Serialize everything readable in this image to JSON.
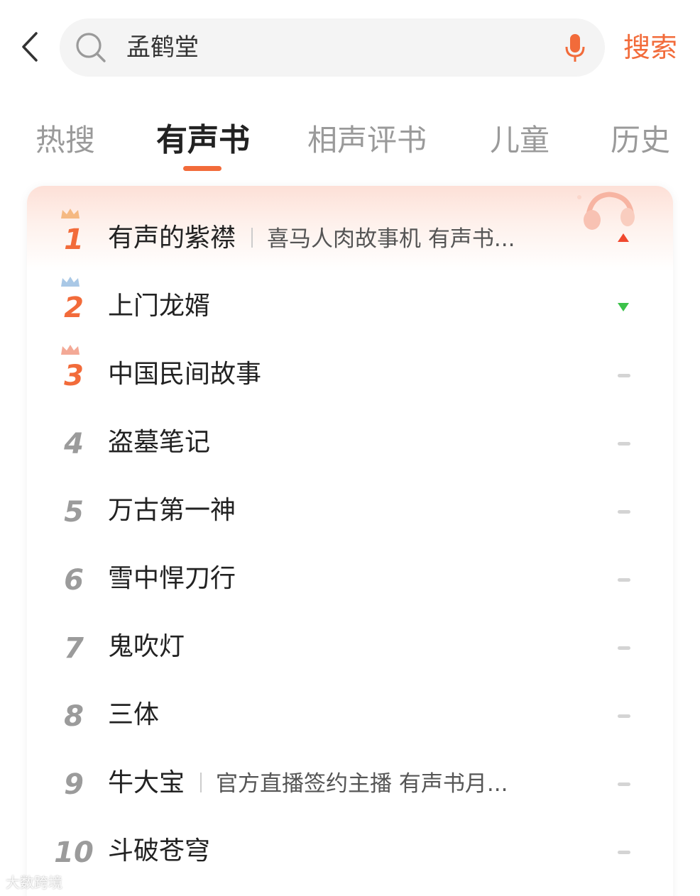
{
  "search": {
    "value": "孟鹤堂",
    "button_label": "搜索"
  },
  "tabs": [
    {
      "label": "热搜",
      "active": false
    },
    {
      "label": "有声书",
      "active": true
    },
    {
      "label": "相声评书",
      "active": false
    },
    {
      "label": "儿童",
      "active": false
    },
    {
      "label": "历史",
      "active": false
    }
  ],
  "ranking": [
    {
      "rank": "1",
      "title": "有声的紫襟",
      "subtitle": "喜马人肉故事机  有声书...",
      "trend": "up"
    },
    {
      "rank": "2",
      "title": "上门龙婿",
      "subtitle": "",
      "trend": "down"
    },
    {
      "rank": "3",
      "title": "中国民间故事",
      "subtitle": "",
      "trend": "flat"
    },
    {
      "rank": "4",
      "title": "盗墓笔记",
      "subtitle": "",
      "trend": "flat"
    },
    {
      "rank": "5",
      "title": "万古第一神",
      "subtitle": "",
      "trend": "flat"
    },
    {
      "rank": "6",
      "title": "雪中悍刀行",
      "subtitle": "",
      "trend": "flat"
    },
    {
      "rank": "7",
      "title": "鬼吹灯",
      "subtitle": "",
      "trend": "flat"
    },
    {
      "rank": "8",
      "title": "三体",
      "subtitle": "",
      "trend": "flat"
    },
    {
      "rank": "9",
      "title": "牛大宝",
      "subtitle": "官方直播签约主播  有声书月...",
      "trend": "flat"
    },
    {
      "rank": "10",
      "title": "斗破苍穹",
      "subtitle": "",
      "trend": "flat"
    }
  ],
  "colors": {
    "accent": "#f26b3a",
    "trend_up": "#f0482e",
    "trend_down": "#3cc24a",
    "crown_1": "#f5b982",
    "crown_2": "#a9c8e6",
    "crown_3": "#f3a996"
  },
  "icons": {
    "back": "chevron-left-icon",
    "search": "search-icon",
    "mic": "mic-icon"
  },
  "watermark": "大数跨境"
}
